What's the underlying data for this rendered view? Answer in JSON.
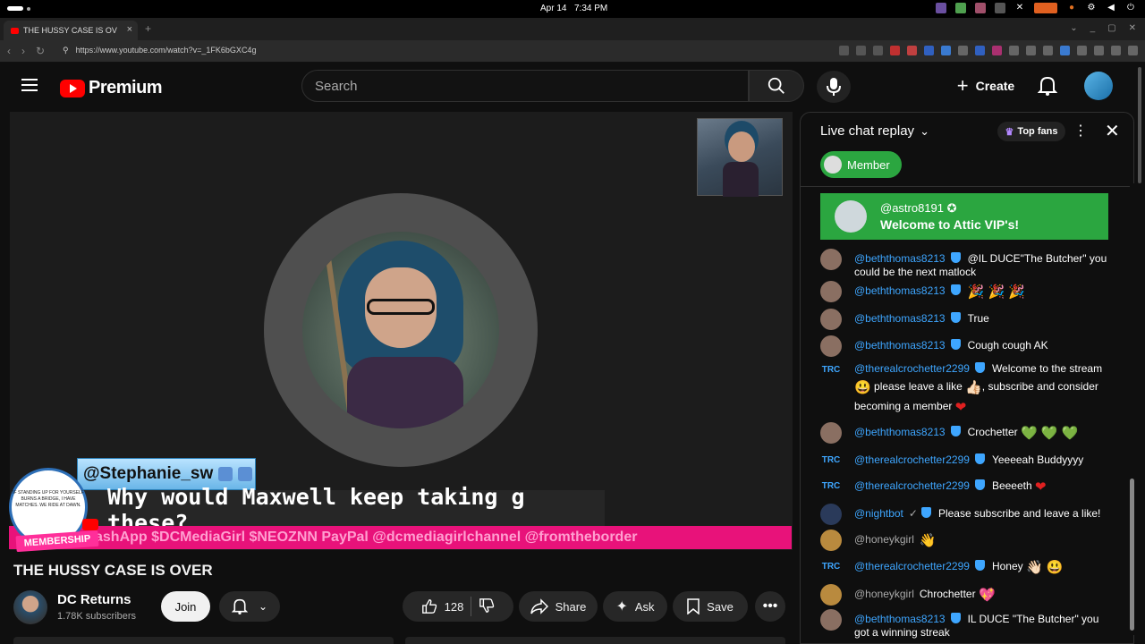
{
  "system": {
    "date": "Apr 14",
    "time": "7:34 PM"
  },
  "browser": {
    "tab_title": "THE HUSSY CASE IS OV",
    "url": "https://www.youtube.com/watch?v=_1FK6bGXC4g"
  },
  "header": {
    "logo_text": "Premium",
    "search_placeholder": "Search",
    "create_label": "Create"
  },
  "overlay": {
    "username": "@Stephanie_sw",
    "message": "Why would Maxwell keep taking g these?",
    "ticker": "ashApp $DCMediaGirl $NEOZNN PayPal @dcmediagirlchannel @fromtheborder",
    "membership_label": "MEMBERSHIP",
    "membership_text": "IF STANDING UP FOR YOURSELF BURNS A BRIDGE, I HAVE MATCHES. WE RIDE AT DAWN."
  },
  "video": {
    "title": "THE HUSSY CASE IS OVER",
    "channel": "DC Returns",
    "subscribers": "1.78K subscribers",
    "join_label": "Join",
    "like_count": "128",
    "share_label": "Share",
    "ask_label": "Ask",
    "save_label": "Save"
  },
  "chat": {
    "title": "Live chat replay",
    "top_fans_label": "Top fans",
    "member_chip_label": "Member",
    "welcome": {
      "name": "@astro8191",
      "message": "Welcome to Attic VIP's!"
    },
    "messages": [
      {
        "author": "@beththomas8213",
        "text": "@IL DUCE\"The Butcher\" you could be the next matlock"
      },
      {
        "author": "@beththomas8213",
        "text": "🎉 🎉 🎉"
      },
      {
        "author": "@beththomas8213",
        "text": "True"
      },
      {
        "author": "@beththomas8213",
        "text": "Cough cough AK"
      },
      {
        "author": "@therealcrochetter2299",
        "text_1": "Welcome to the stream",
        "text_2": "please leave a like",
        "text_3": ", subscribe and consider becoming a member"
      },
      {
        "author": "@beththomas8213",
        "text": "Crochetter"
      },
      {
        "author": "@therealcrochetter2299",
        "text": "Yeeeeah Buddyyyy"
      },
      {
        "author": "@therealcrochetter2299",
        "text": "Beeeeth"
      },
      {
        "author": "@nightbot",
        "text": "Please subscribe and leave a like!"
      },
      {
        "author": "@honeykgirl",
        "text": "👋"
      },
      {
        "author": "@therealcrochetter2299",
        "text": "Honey"
      },
      {
        "author": "@honeykgirl",
        "text": "Chrochetter"
      },
      {
        "author": "@beththomas8213",
        "text": "IL DUCE \"The Butcher\" you got a winning streak"
      }
    ],
    "trc_label": "TRC"
  },
  "colors": {
    "brand_red": "#ff0000",
    "member_green": "#2ba640",
    "link_blue": "#3ea6ff",
    "ticker_pink": "#e8127a"
  }
}
